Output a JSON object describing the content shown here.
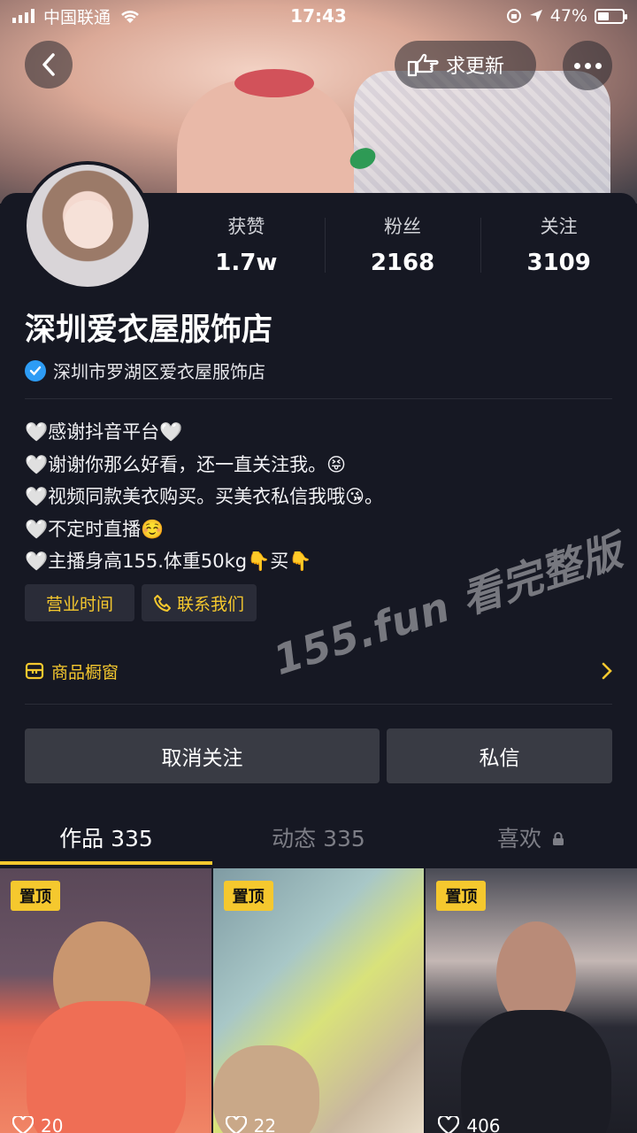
{
  "status_bar": {
    "carrier": "中国联通",
    "time": "17:43",
    "battery": "47%",
    "battery_level": 0.47
  },
  "header": {
    "back_icon": "chevron-left-icon",
    "update_button": "求更新",
    "update_icon": "hand-pointing-icon",
    "more_icon": "more-dots-icon"
  },
  "profile": {
    "stats": [
      {
        "label": "获赞",
        "value": "1.7w"
      },
      {
        "label": "粉丝",
        "value": "2168"
      },
      {
        "label": "关注",
        "value": "3109"
      }
    ],
    "name": "深圳爱衣屋服饰店",
    "verified_name": "深圳市罗湖区爱衣屋服饰店",
    "bio": [
      "🤍感谢抖音平台🤍",
      "🤍谢谢你那么好看，还一直关注我。😝",
      "🤍视频同款美衣购买。买美衣私信我哦😘。",
      "🤍不定时直播☺️",
      "🤍主播身高155.体重50kg👇买👇"
    ],
    "tags": {
      "hours": "营业时间",
      "contact": "联系我们"
    },
    "shop": "商品橱窗",
    "watermark": "155.fun 看完整版"
  },
  "actions": {
    "unfollow": "取消关注",
    "message": "私信"
  },
  "tabs": [
    {
      "label": "作品 335",
      "active": true
    },
    {
      "label": "动态 335",
      "active": false
    },
    {
      "label": "喜欢",
      "active": false
    }
  ],
  "videos": [
    {
      "pinned": "置顶",
      "likes": "20"
    },
    {
      "pinned": "置顶",
      "likes": "22"
    },
    {
      "pinned": "置顶",
      "likes": "406"
    }
  ],
  "colors": {
    "background": "#161823",
    "accent": "#f5c82e",
    "button": "#393b44",
    "verified": "#2d9cf5"
  }
}
